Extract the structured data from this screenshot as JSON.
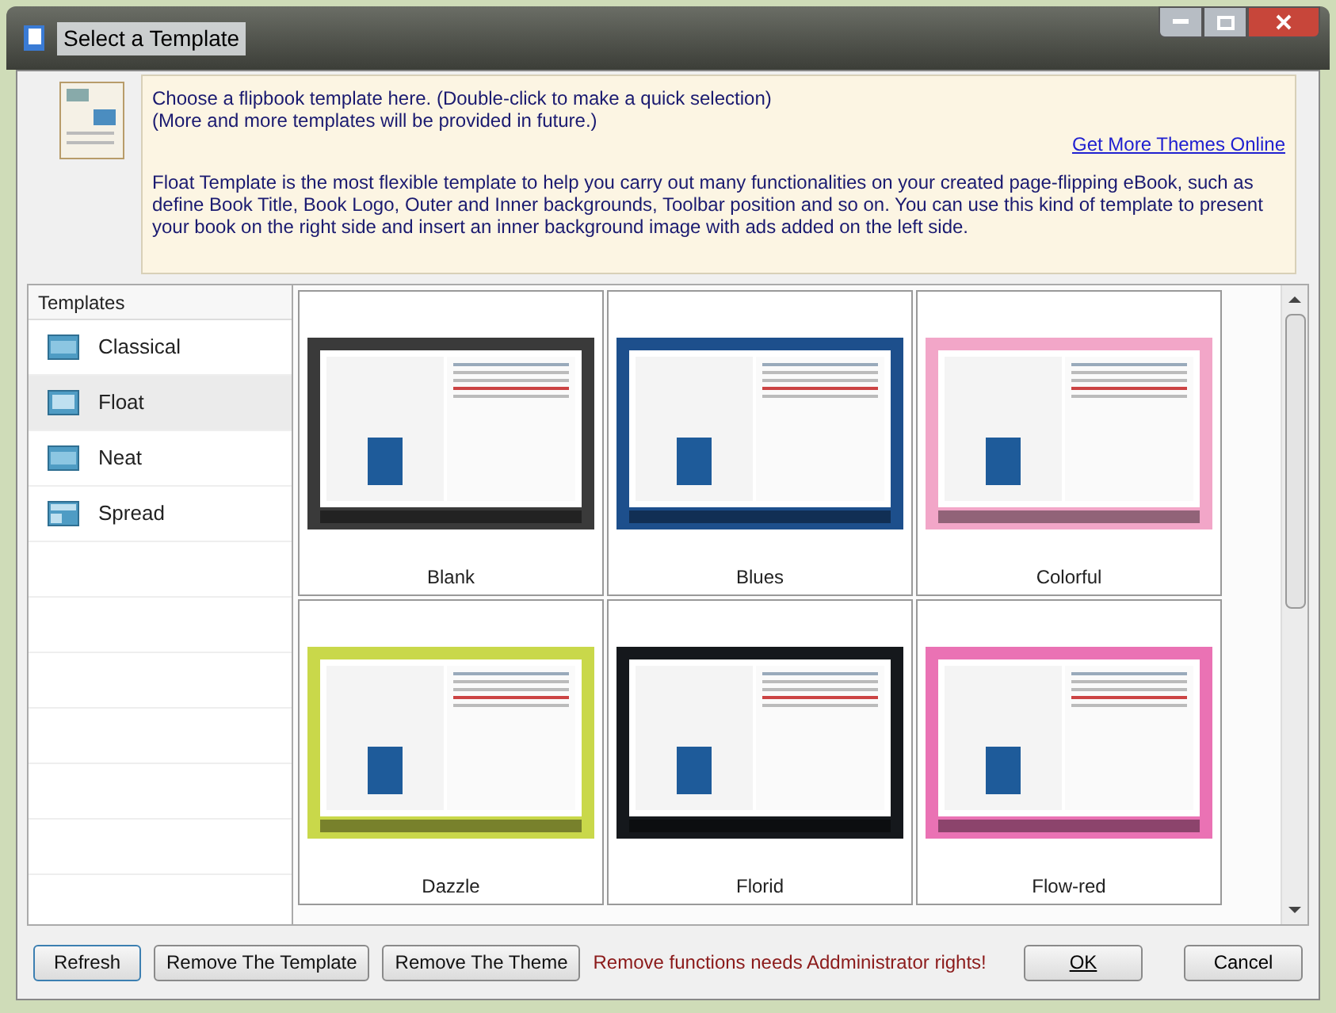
{
  "window": {
    "title": "Select a Template"
  },
  "info": {
    "line_1": "Choose a flipbook template here. (Double-click to make a quick selection)",
    "line_2": "(More and more templates will be provided in future.)",
    "link": "Get More Themes Online",
    "description": "Float Template is the most flexible template to help you carry out many functionalities on your created page-flipping eBook, such as define Book Title, Book Logo, Outer and Inner backgrounds, Toolbar position and so on. You can use this kind of template to present your book on the right side and insert an inner background image with ads added on the left side."
  },
  "sidebar": {
    "header": "Templates",
    "items": [
      {
        "label": "Classical",
        "selected": false
      },
      {
        "label": "Float",
        "selected": true
      },
      {
        "label": "Neat",
        "selected": false
      },
      {
        "label": "Spread",
        "selected": false
      }
    ]
  },
  "templates": [
    {
      "name": "Blank",
      "color": "#3a3a3a"
    },
    {
      "name": "Blues",
      "color": "#1d4f8c"
    },
    {
      "name": "Colorful",
      "color": "#f2a6c8"
    },
    {
      "name": "Dazzle",
      "color": "#c9d84a"
    },
    {
      "name": "Florid",
      "color": "#15181c"
    },
    {
      "name": "Flow-red",
      "color": "#ea72b4"
    }
  ],
  "footer": {
    "buttons": [
      "Refresh",
      "Remove The Template",
      "Remove The Theme"
    ],
    "warning": "Remove functions needs Addministrator rights!",
    "ok": "OK",
    "cancel": "Cancel"
  }
}
